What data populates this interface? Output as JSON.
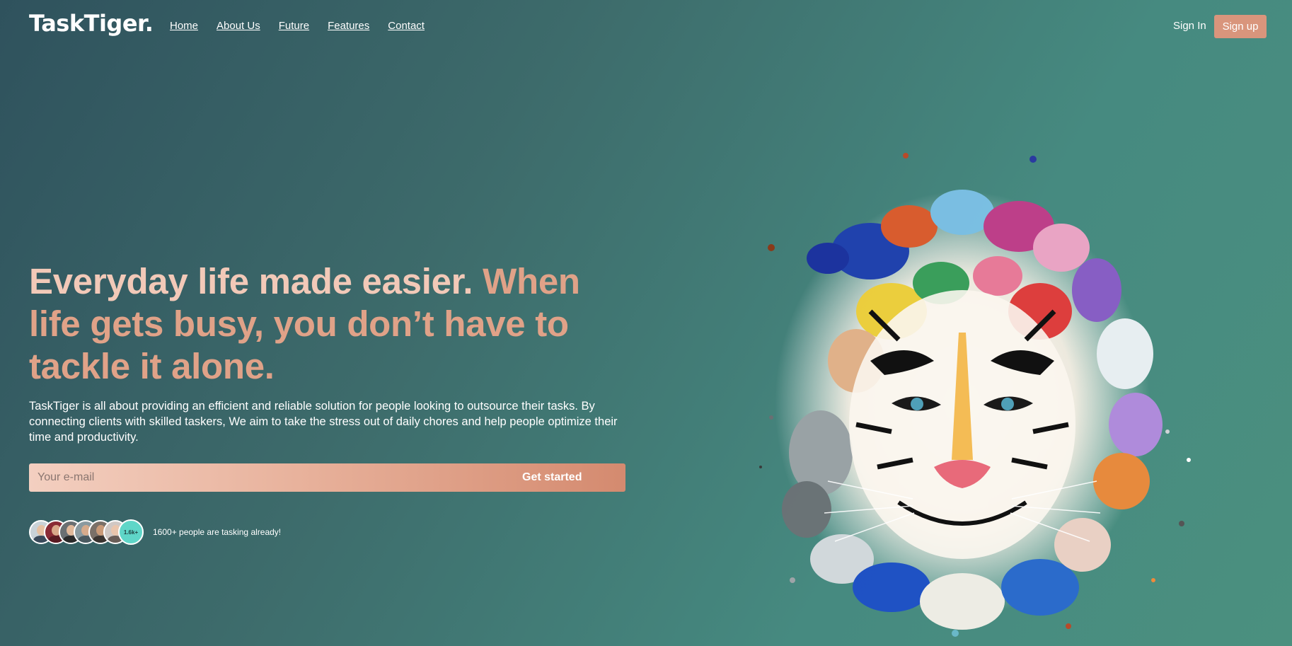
{
  "header": {
    "logo": "TaskTiger.",
    "nav": [
      "Home",
      "About Us",
      "Future",
      "Features",
      "Contact"
    ],
    "sign_in": "Sign In",
    "sign_up": "Sign up"
  },
  "hero": {
    "headline_part1": "Everyday life made easier. ",
    "headline_part2": "When life gets busy, you don’t have to tackle it alone.",
    "description": "TaskTiger is all about providing an efficient and reliable solution for people looking to outsource their tasks. By connecting clients with skilled taskers, We aim to take the stress out of daily chores and help people optimize their time and productivity.",
    "email_placeholder": "Your e-mail",
    "cta": "Get started",
    "social_proof": {
      "badge": "1.6k+",
      "text": "1600+ people are tasking already!"
    }
  },
  "colors": {
    "accent": "#d9957c",
    "headline_light": "#f2c9b8",
    "headline_dark": "#e0a288",
    "badge": "#5fd6c8",
    "background_from": "#2f525d",
    "background_to": "#4b907f"
  },
  "icons": {
    "avatars": [
      "avatar",
      "avatar",
      "avatar",
      "avatar",
      "avatar",
      "avatar"
    ],
    "hero_image": "colorful-tiger-illustration"
  }
}
